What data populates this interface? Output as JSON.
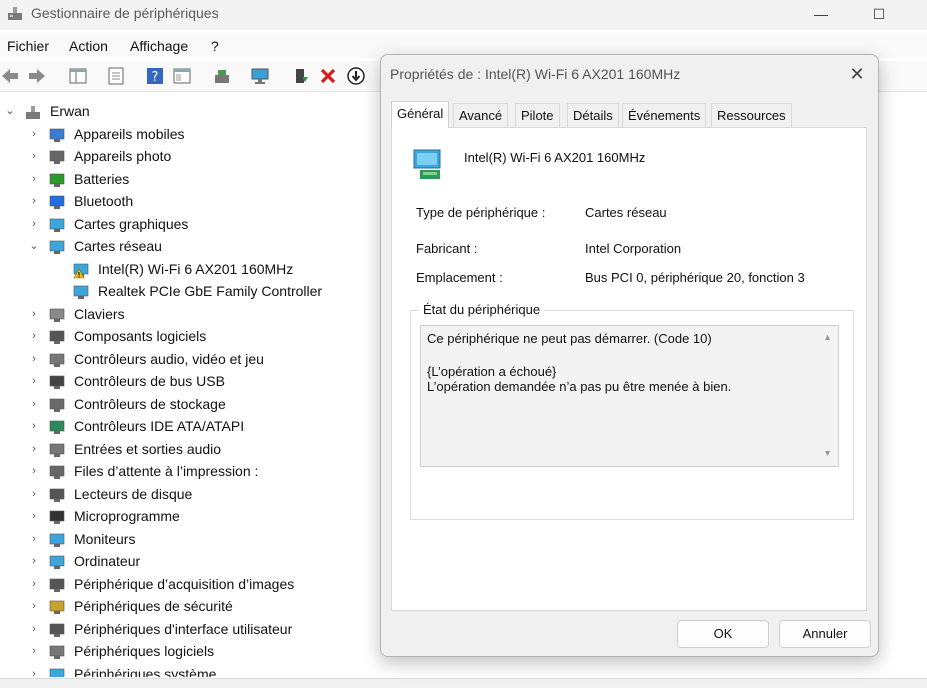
{
  "window": {
    "title": "Gestionnaire de périphériques",
    "minimize_glyph": "—",
    "maximize_glyph": "☐"
  },
  "menu": [
    "Fichier",
    "Action",
    "Affichage",
    "?"
  ],
  "tree": {
    "root": "Erwan",
    "items": [
      {
        "label": "Appareils mobiles",
        "icon": "mobile-device-icon"
      },
      {
        "label": "Appareils photo",
        "icon": "camera-icon"
      },
      {
        "label": "Batteries",
        "icon": "battery-icon"
      },
      {
        "label": "Bluetooth",
        "icon": "bluetooth-icon"
      },
      {
        "label": "Cartes graphiques",
        "icon": "display-adapter-icon"
      },
      {
        "label": "Cartes réseau",
        "icon": "network-adapter-icon",
        "expanded": true,
        "children": [
          {
            "label": "Intel(R) Wi-Fi 6 AX201 160MHz",
            "icon": "network-warning-icon"
          },
          {
            "label": "Realtek PCIe GbE Family Controller",
            "icon": "network-adapter-icon"
          }
        ]
      },
      {
        "label": "Claviers",
        "icon": "keyboard-icon"
      },
      {
        "label": "Composants logiciels",
        "icon": "software-component-icon"
      },
      {
        "label": "Contrôleurs audio, vidéo et jeu",
        "icon": "speaker-icon"
      },
      {
        "label": "Contrôleurs de bus USB",
        "icon": "usb-icon"
      },
      {
        "label": "Contrôleurs de stockage",
        "icon": "storage-controller-icon"
      },
      {
        "label": "Contrôleurs IDE ATA/ATAPI",
        "icon": "ide-controller-icon"
      },
      {
        "label": "Entrées et sorties audio",
        "icon": "audio-io-icon"
      },
      {
        "label": "Files d’attente à l’impression :",
        "icon": "printer-icon"
      },
      {
        "label": "Lecteurs de disque",
        "icon": "disk-drive-icon"
      },
      {
        "label": "Microprogramme",
        "icon": "firmware-icon"
      },
      {
        "label": "Moniteurs",
        "icon": "monitor-icon"
      },
      {
        "label": "Ordinateur",
        "icon": "computer-icon"
      },
      {
        "label": "Périphérique d’acquisition d’images",
        "icon": "imaging-icon"
      },
      {
        "label": "Périphériques de sécurité",
        "icon": "security-device-icon"
      },
      {
        "label": "Périphériques d'interface utilisateur",
        "icon": "hid-icon"
      },
      {
        "label": "Périphériques logiciels",
        "icon": "software-device-icon"
      },
      {
        "label": "Périphériques système",
        "icon": "system-device-icon"
      }
    ]
  },
  "dialog": {
    "title": "Propriétés de : Intel(R) Wi-Fi 6 AX201 160MHz",
    "close_glyph": "✕",
    "tabs": [
      "Général",
      "Avancé",
      "Pilote",
      "Détails",
      "Événements",
      "Ressources"
    ],
    "active_tab": "Général",
    "device_name": "Intel(R) Wi-Fi 6 AX201 160MHz",
    "props": [
      {
        "label": "Type de périphérique :",
        "value": "Cartes réseau"
      },
      {
        "label": "Fabricant :",
        "value": "Intel Corporation"
      },
      {
        "label": "Emplacement :",
        "value": "Bus PCI 0, périphérique 20, fonction 3"
      }
    ],
    "status_group_title": "État du périphérique",
    "status_lines": [
      "Ce périphérique ne peut pas démarrer. (Code 10)",
      "",
      "{L’opération a échoué}",
      "L’opération demandée n’a pas pu être menée à bien."
    ],
    "ok_label": "OK",
    "cancel_label": "Annuler"
  }
}
